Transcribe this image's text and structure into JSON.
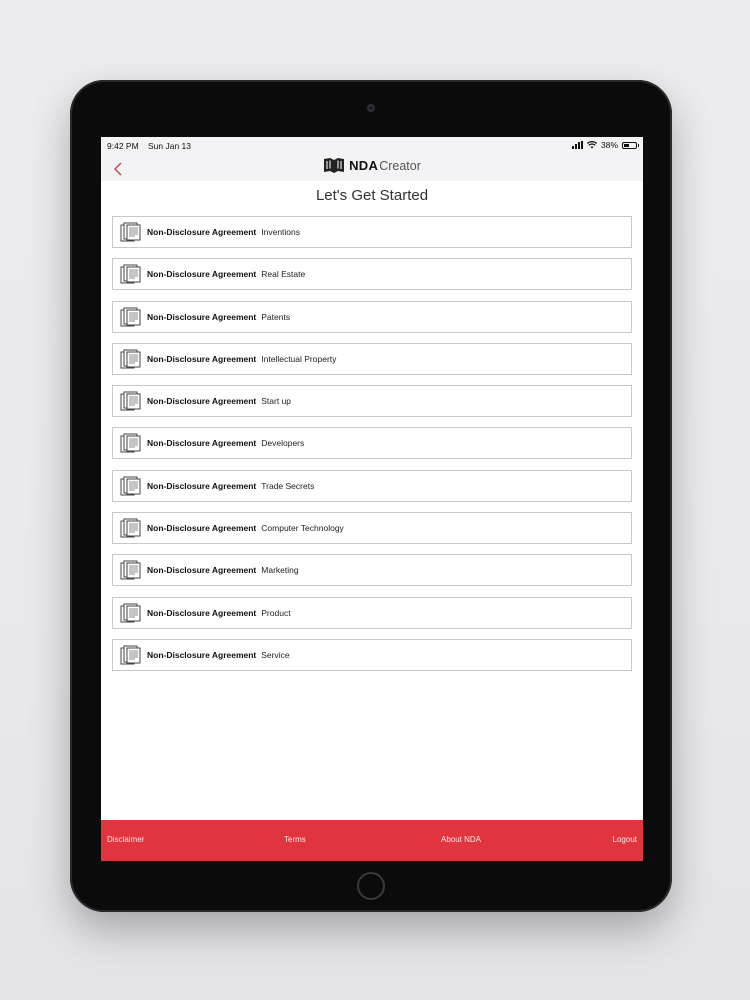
{
  "status_bar": {
    "time": "9:42 PM",
    "date": "Sun Jan 13",
    "battery": "38%",
    "icons": [
      "signal-icon",
      "wifi-icon",
      "battery-icon"
    ]
  },
  "nav": {
    "back_icon": "chevron-left-icon",
    "brand_bold": "NDA",
    "brand_light": "Creator"
  },
  "main": {
    "title": "Let's Get Started",
    "item_prefix": "Non-Disclosure Agreement",
    "items": [
      {
        "label": "Inventions"
      },
      {
        "label": "Real Estate"
      },
      {
        "label": "Patents"
      },
      {
        "label": "Intellectual Property"
      },
      {
        "label": "Start up"
      },
      {
        "label": "Developers"
      },
      {
        "label": "Trade Secrets"
      },
      {
        "label": "Computer Technology"
      },
      {
        "label": "Marketing"
      },
      {
        "label": "Product"
      },
      {
        "label": "Service"
      }
    ]
  },
  "footer": {
    "disclaimer": "Disclaimer",
    "terms": "Terms",
    "about": "About NDA",
    "logout": "Logout"
  },
  "colors": {
    "accent": "#e0343f",
    "back_arrow": "#c8404a",
    "device_bezel": "#0b0b0c"
  }
}
